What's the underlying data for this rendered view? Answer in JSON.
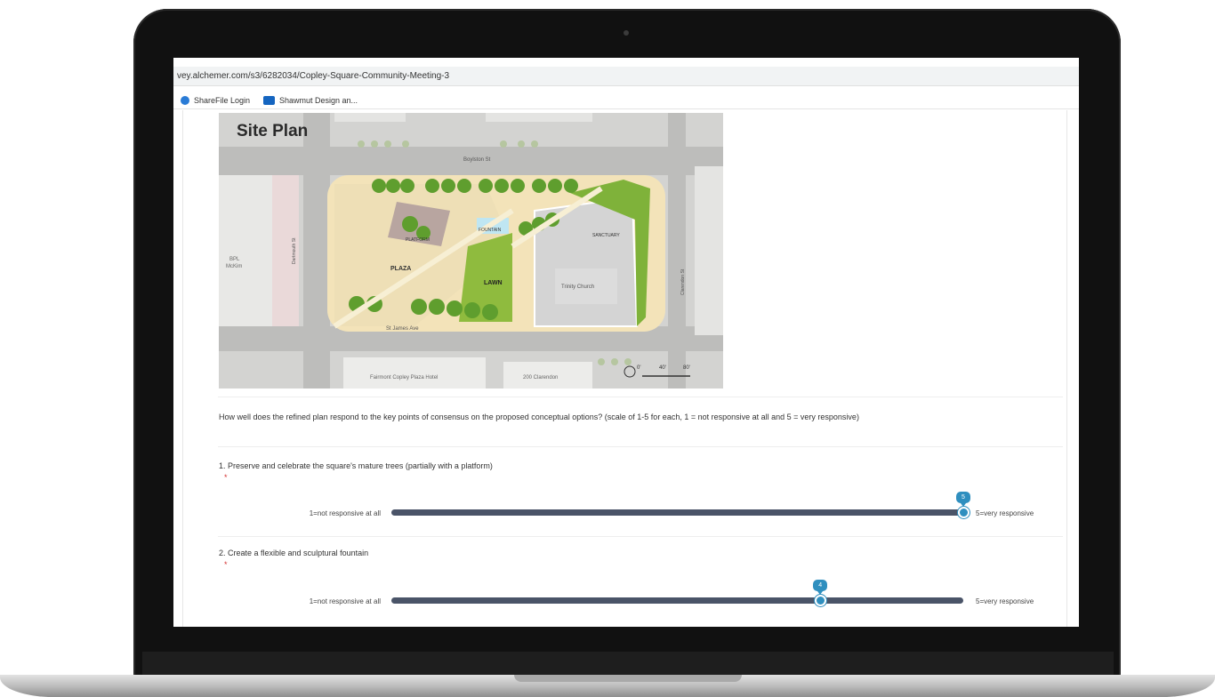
{
  "browser": {
    "url": "vey.alchemer.com/s3/6282034/Copley-Square-Community-Meeting-3",
    "bookmarks": [
      {
        "label": "ShareFile Login",
        "icon": "sharefile-icon"
      },
      {
        "label": "Shawmut Design an...",
        "icon": "outlook-icon"
      }
    ]
  },
  "site_plan": {
    "title": "Site Plan",
    "labels": {
      "boylston": "Boylston St",
      "platform": "PLATFORM",
      "fountain": "FOUNTAIN",
      "plaza": "PLAZA",
      "lawn": "LAWN",
      "trinity": "Trinity Church",
      "sanctuary": "SANCTUARY",
      "bpl": "BPL",
      "mckim": "McKim",
      "dartmouth": "Dartmouth St",
      "clarendon": "Clarendon St",
      "st_james": "St James Ave",
      "fairmont": "Fairmont Copley Plaza Hotel",
      "clarendon_200": "200 Clarendon",
      "scale_0": "0'",
      "scale_40": "40'",
      "scale_80": "80'"
    }
  },
  "survey": {
    "question": "How well does the refined plan respond to the key points of consensus on the proposed conceptual options? (scale of 1-5 for each, 1 = not responsive at all and 5 = very responsive)",
    "items": [
      {
        "label": "1. Preserve and celebrate the square's mature trees (partially with a platform)",
        "required_mark": "*",
        "min_label": "1=not responsive at all",
        "max_label": "5=very responsive",
        "value": "5",
        "value_fraction": 1.0
      },
      {
        "label": "2. Create a flexible and sculptural fountain",
        "required_mark": "*",
        "min_label": "1=not responsive at all",
        "max_label": "5=very responsive",
        "value": "4",
        "value_fraction": 0.75
      }
    ]
  },
  "colors": {
    "slider_track": "#4a5468",
    "slider_thumb": "#2f8fbf",
    "required": "#d32f2f"
  }
}
